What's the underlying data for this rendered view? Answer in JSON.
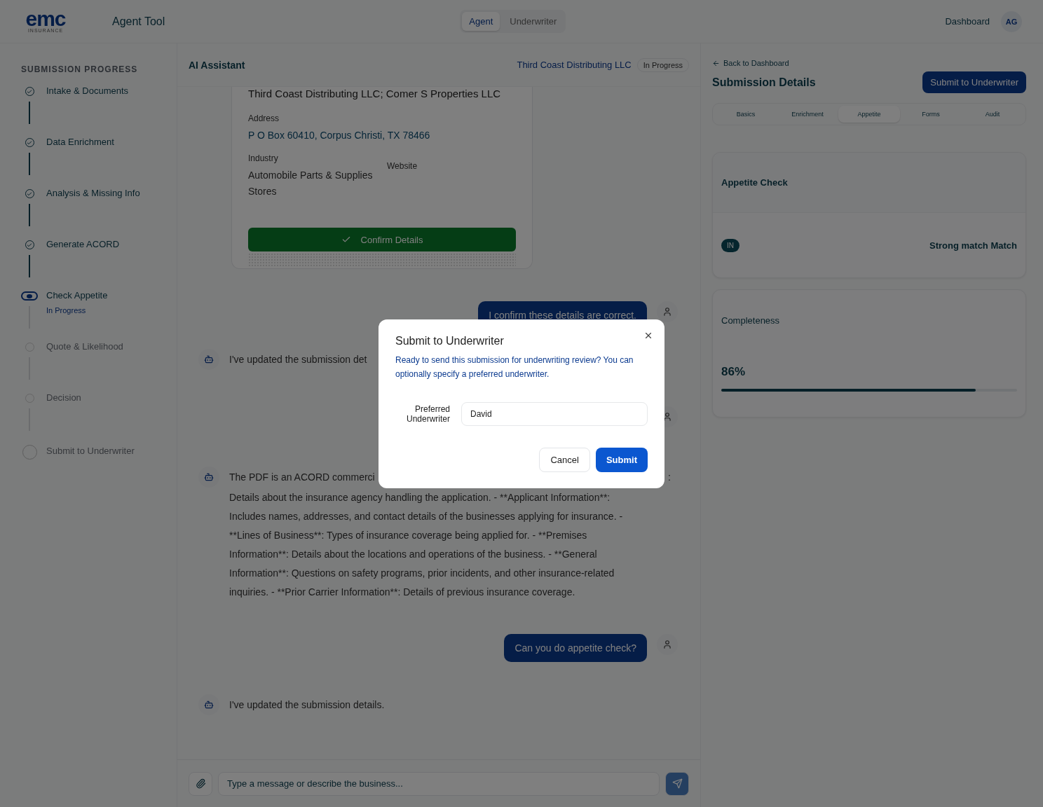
{
  "header": {
    "logo": {
      "mark": "emc",
      "sub": "INSURANCE"
    },
    "title": "Agent Tool",
    "roles": [
      {
        "label": "Agent",
        "selected": true
      },
      {
        "label": "Underwriter",
        "selected": false
      }
    ],
    "dashboard": "Dashboard",
    "avatar": "AG"
  },
  "sidebar": {
    "title": "SUBMISSION PROGRESS",
    "steps": [
      {
        "label": "Intake & Documents",
        "kind": "done"
      },
      {
        "label": "Data Enrichment",
        "kind": "done"
      },
      {
        "label": "Analysis & Missing Info",
        "kind": "done"
      },
      {
        "label": "Generate ACORD",
        "kind": "done"
      },
      {
        "label": "Check Appetite",
        "kind": "current",
        "note": "In Progress"
      },
      {
        "label": "Quote & Likelihood",
        "kind": "pending"
      },
      {
        "label": "Decision",
        "kind": "pending"
      },
      {
        "label": "Submit to Underwriter",
        "kind": "pending"
      }
    ]
  },
  "chat": {
    "title": "AI Assistant",
    "company": "Third Coast Distributing LLC",
    "status": "In Progress",
    "card": {
      "names": "Third Coast Distributing LLC; Comer S Properties LLC",
      "address_label": "Address",
      "address": "P O Box 60410, Corpus Christi, TX 78466",
      "industry_label": "Industry",
      "industry": "Automobile Parts & Supplies Stores",
      "website_label": "Website",
      "confirm": "Confirm Details"
    },
    "messages": [
      {
        "kind": "user",
        "text": "I confirm these details are correct."
      },
      {
        "kind": "bot",
        "text": "I've updated the submission det"
      },
      {
        "kind": "user"
      },
      {
        "kind": "bot",
        "first_line": "The PDF is an ACORD commerci",
        "first_line_end": ":",
        "text": "Details about the insurance agency handling the application. - **Applicant Information**: Includes names, addresses, and contact details of the businesses applying for insurance. - **Lines of Business**: Types of insurance coverage being applied for. - **Premises Information**: Details about the locations and operations of the business. - **General Information**: Questions on safety programs, prior incidents, and other insurance-related inquiries. - **Prior Carrier Information**: Details of previous insurance coverage."
      },
      {
        "kind": "user",
        "text": "Can you do appetite check?"
      },
      {
        "kind": "bot",
        "text": "I've updated the submission details."
      }
    ],
    "input": {
      "placeholder": "Type a message or describe the business..."
    }
  },
  "details": {
    "back": "Back to Dashboard",
    "title": "Submission Details",
    "submit": "Submit to Underwriter",
    "tabs": [
      {
        "label": "Basics",
        "selected": false
      },
      {
        "label": "Enrichment",
        "selected": false
      },
      {
        "label": "Appetite",
        "selected": true
      },
      {
        "label": "Forms",
        "selected": false
      },
      {
        "label": "Audit",
        "selected": false
      }
    ],
    "appetite": {
      "title": "Appetite Check",
      "badge": "IN",
      "match": "Strong match Match"
    },
    "completeness": {
      "title": "Completeness",
      "value": "86%",
      "level": 0.86
    }
  },
  "dialog": {
    "title": "Submit to Underwriter",
    "text": "Ready to send this submission for underwriting review? You can optionally specify a preferred underwriter.",
    "field_label": "Preferred Underwriter",
    "field_value": "David",
    "cancel": "Cancel",
    "submit": "Submit"
  }
}
